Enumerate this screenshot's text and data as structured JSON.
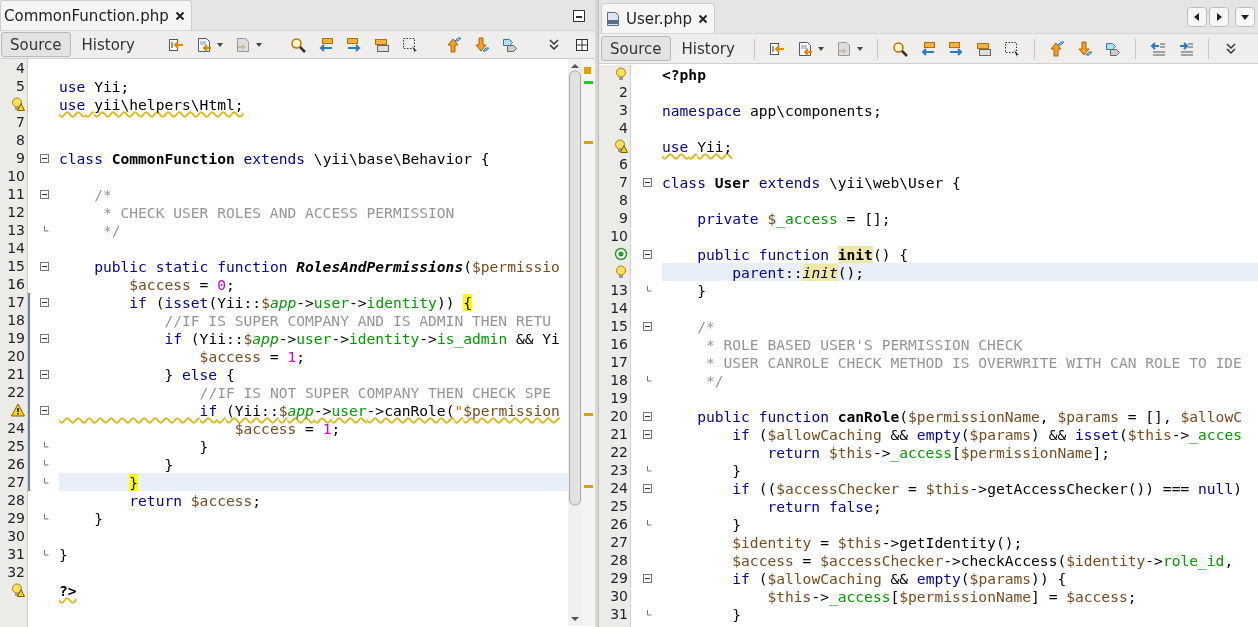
{
  "panes": [
    {
      "tab": {
        "label": "CommonFunction.php"
      },
      "views": [
        {
          "label": "Source",
          "selected": true
        },
        {
          "label": "History",
          "selected": false
        }
      ],
      "lines": [
        {
          "n": "4",
          "current": false
        },
        {
          "n": "5",
          "current": false,
          "code": [
            {
              "kind": "keyword",
              "text": "use"
            },
            {
              "kind": "plain",
              "text": " Yii;"
            }
          ]
        },
        {
          "annotation": {
            "kind": "bulb-warning"
          },
          "squiggle": true,
          "current": false,
          "code": [
            {
              "kind": "keyword",
              "text": "use"
            },
            {
              "kind": "plain",
              "text": " yii\\helpers\\Html;"
            }
          ]
        },
        {
          "n": "7",
          "current": false
        },
        {
          "n": "8",
          "current": false
        },
        {
          "n": "9",
          "fold": {
            "kind": "open"
          },
          "current": false,
          "code": [
            {
              "kind": "keyword",
              "text": "class "
            },
            {
              "kind": "bold",
              "text": "CommonFunction"
            },
            {
              "kind": "keyword",
              "text": " extends"
            },
            {
              "kind": "plain",
              "text": " \\yii\\base\\Behavior {"
            }
          ]
        },
        {
          "n": "10",
          "current": false
        },
        {
          "n": "11",
          "fold": {
            "kind": "open"
          },
          "current": false,
          "code": [
            {
              "kind": "comment",
              "text": "    /*"
            }
          ]
        },
        {
          "n": "12",
          "current": false,
          "code": [
            {
              "kind": "comment",
              "text": "     * CHECK USER ROLES AND ACCESS PERMISSION"
            }
          ]
        },
        {
          "n": "13",
          "fold": {
            "kind": "end"
          },
          "current": false,
          "code": [
            {
              "kind": "comment",
              "text": "     */"
            }
          ]
        },
        {
          "n": "14",
          "current": false
        },
        {
          "n": "15",
          "fold": {
            "kind": "open"
          },
          "current": false,
          "code": [
            {
              "kind": "keyword",
              "text": "    public static function "
            },
            {
              "kind": "bold-italic",
              "text": "RolesAndPermissions"
            },
            {
              "kind": "plain",
              "text": "("
            },
            {
              "kind": "variable",
              "text": "$permissio"
            }
          ]
        },
        {
          "n": "16",
          "current": false,
          "code": [
            {
              "kind": "variable",
              "text": "        $access"
            },
            {
              "kind": "plain",
              "text": " = "
            },
            {
              "kind": "number",
              "text": "0"
            },
            {
              "kind": "plain",
              "text": ";"
            }
          ]
        },
        {
          "n": "17",
          "fold": {
            "kind": "open"
          },
          "changed": true,
          "current": false,
          "code": [
            {
              "kind": "keyword",
              "text": "        if"
            },
            {
              "kind": "plain",
              "text": " ("
            },
            {
              "kind": "keyword",
              "text": "isset"
            },
            {
              "kind": "plain",
              "text": "(Yii::"
            },
            {
              "kind": "variable",
              "text": "$"
            },
            {
              "kind": "field-italic",
              "text": "app"
            },
            {
              "kind": "plain",
              "text": "->"
            },
            {
              "kind": "field",
              "text": "user"
            },
            {
              "kind": "plain",
              "text": "->"
            },
            {
              "kind": "field",
              "text": "identity"
            },
            {
              "kind": "plain",
              "text": ")) "
            },
            {
              "kind": "brace-match",
              "text": "{"
            }
          ]
        },
        {
          "n": "18",
          "changed": true,
          "current": false,
          "code": [
            {
              "kind": "comment",
              "text": "            //IF IS SUPER COMPANY AND IS ADMIN THEN RETU"
            }
          ]
        },
        {
          "n": "19",
          "fold": {
            "kind": "open"
          },
          "changed": true,
          "current": false,
          "code": [
            {
              "kind": "keyword",
              "text": "            if"
            },
            {
              "kind": "plain",
              "text": " (Yii::"
            },
            {
              "kind": "variable",
              "text": "$"
            },
            {
              "kind": "field-italic",
              "text": "app"
            },
            {
              "kind": "plain",
              "text": "->"
            },
            {
              "kind": "field",
              "text": "user"
            },
            {
              "kind": "plain",
              "text": "->"
            },
            {
              "kind": "field",
              "text": "identity"
            },
            {
              "kind": "plain",
              "text": "->"
            },
            {
              "kind": "field",
              "text": "is_admin"
            },
            {
              "kind": "plain",
              "text": " && Yi"
            }
          ]
        },
        {
          "n": "20",
          "changed": true,
          "current": false,
          "code": [
            {
              "kind": "variable",
              "text": "                $access"
            },
            {
              "kind": "plain",
              "text": " = "
            },
            {
              "kind": "number",
              "text": "1"
            },
            {
              "kind": "plain",
              "text": ";"
            }
          ]
        },
        {
          "n": "21",
          "fold": {
            "kind": "open"
          },
          "changed": true,
          "current": false,
          "code": [
            {
              "kind": "plain",
              "text": "            } "
            },
            {
              "kind": "keyword",
              "text": "else"
            },
            {
              "kind": "plain",
              "text": " {"
            }
          ]
        },
        {
          "n": "22",
          "changed": true,
          "current": false,
          "code": [
            {
              "kind": "comment",
              "text": "                //IF IS NOT SUPER COMPANY THEN CHECK SPE"
            }
          ]
        },
        {
          "annotation": {
            "kind": "warning"
          },
          "fold": {
            "kind": "open"
          },
          "squiggle": true,
          "changed": true,
          "current": false,
          "code": [
            {
              "kind": "keyword",
              "text": "                if"
            },
            {
              "kind": "plain",
              "text": " (Yii::"
            },
            {
              "kind": "variable",
              "text": "$"
            },
            {
              "kind": "field-italic",
              "text": "app"
            },
            {
              "kind": "plain",
              "text": "->"
            },
            {
              "kind": "field",
              "text": "user"
            },
            {
              "kind": "plain",
              "text": "->canRole("
            },
            {
              "kind": "string",
              "text": "\""
            },
            {
              "kind": "variable",
              "text": "$permission"
            }
          ]
        },
        {
          "n": "24",
          "changed": true,
          "current": false,
          "code": [
            {
              "kind": "variable",
              "text": "                    $access"
            },
            {
              "kind": "plain",
              "text": " = "
            },
            {
              "kind": "number",
              "text": "1"
            },
            {
              "kind": "plain",
              "text": ";"
            }
          ]
        },
        {
          "n": "25",
          "fold": {
            "kind": "end"
          },
          "changed": true,
          "current": false,
          "code": [
            {
              "kind": "plain",
              "text": "                }"
            }
          ]
        },
        {
          "n": "26",
          "fold": {
            "kind": "end"
          },
          "changed": true,
          "current": false,
          "code": [
            {
              "kind": "plain",
              "text": "            }"
            }
          ]
        },
        {
          "n": "27",
          "fold": {
            "kind": "end"
          },
          "changed": true,
          "current": true,
          "code": [
            {
              "kind": "brace-match",
              "text": "        }"
            }
          ]
        },
        {
          "n": "28",
          "current": false,
          "code": [
            {
              "kind": "keyword",
              "text": "        return"
            },
            {
              "kind": "variable",
              "text": " $access"
            },
            {
              "kind": "plain",
              "text": ";"
            }
          ]
        },
        {
          "n": "29",
          "fold": {
            "kind": "end"
          },
          "current": false,
          "code": [
            {
              "kind": "plain",
              "text": "    }"
            }
          ]
        },
        {
          "n": "30",
          "current": false
        },
        {
          "n": "31",
          "fold": {
            "kind": "end"
          },
          "current": false,
          "code": [
            {
              "kind": "plain",
              "text": "}"
            }
          ]
        },
        {
          "n": "32",
          "current": false
        },
        {
          "annotation": {
            "kind": "bulb-warning"
          },
          "squiggle": true,
          "current": false,
          "code": [
            {
              "kind": "bold",
              "text": "?>"
            }
          ]
        }
      ]
    },
    {
      "tab": {
        "label": "User.php"
      },
      "views": [
        {
          "label": "Source",
          "selected": true
        },
        {
          "label": "History",
          "selected": false
        }
      ],
      "lines": [
        {
          "annotation": {
            "kind": "bulb"
          },
          "current": false,
          "code": [
            {
              "kind": "bold",
              "text": "<?php"
            }
          ]
        },
        {
          "n": "2",
          "current": false
        },
        {
          "n": "3",
          "current": false,
          "code": [
            {
              "kind": "keyword",
              "text": "namespace"
            },
            {
              "kind": "plain",
              "text": " app\\components;"
            }
          ]
        },
        {
          "n": "4",
          "current": false
        },
        {
          "annotation": {
            "kind": "bulb-warning"
          },
          "squiggle": true,
          "current": false,
          "code": [
            {
              "kind": "keyword",
              "text": "use"
            },
            {
              "kind": "plain",
              "text": " Yii;"
            }
          ]
        },
        {
          "n": "6",
          "current": false
        },
        {
          "n": "7",
          "fold": {
            "kind": "open"
          },
          "current": false,
          "code": [
            {
              "kind": "keyword",
              "text": "class "
            },
            {
              "kind": "bold",
              "text": "User"
            },
            {
              "kind": "keyword",
              "text": " extends"
            },
            {
              "kind": "plain",
              "text": " \\yii\\web\\User {"
            }
          ]
        },
        {
          "n": "8",
          "current": false
        },
        {
          "n": "9",
          "current": false,
          "code": [
            {
              "kind": "keyword",
              "text": "    private"
            },
            {
              "kind": "variable",
              "text": " $"
            },
            {
              "kind": "field",
              "text": "_access"
            },
            {
              "kind": "plain",
              "text": " = [];"
            }
          ]
        },
        {
          "n": "10",
          "current": false
        },
        {
          "annotation": {
            "kind": "override"
          },
          "fold": {
            "kind": "open"
          },
          "current": false,
          "code": [
            {
              "kind": "keyword",
              "text": "    public function "
            },
            {
              "kind": "occurrence-bold",
              "text": "init"
            },
            {
              "kind": "plain",
              "text": "() {"
            }
          ]
        },
        {
          "annotation": {
            "kind": "bulb"
          },
          "current": true,
          "code": [
            {
              "kind": "keyword",
              "text": "        parent"
            },
            {
              "kind": "plain",
              "text": "::"
            },
            {
              "kind": "occurrence-italic",
              "text": "init"
            },
            {
              "kind": "plain",
              "text": "();"
            }
          ]
        },
        {
          "n": "13",
          "fold": {
            "kind": "end"
          },
          "current": false,
          "code": [
            {
              "kind": "plain",
              "text": "    }"
            }
          ]
        },
        {
          "n": "14",
          "current": false
        },
        {
          "n": "15",
          "fold": {
            "kind": "open"
          },
          "current": false,
          "code": [
            {
              "kind": "comment",
              "text": "    /*"
            }
          ]
        },
        {
          "n": "16",
          "current": false,
          "code": [
            {
              "kind": "comment",
              "text": "     * ROLE BASED USER'S PERMISSION CHECK"
            }
          ]
        },
        {
          "n": "17",
          "current": false,
          "code": [
            {
              "kind": "comment",
              "text": "     * USER CANROLE CHECK METHOD IS OVERWRITE WITH CAN ROLE TO IDE"
            }
          ]
        },
        {
          "n": "18",
          "fold": {
            "kind": "end"
          },
          "current": false,
          "code": [
            {
              "kind": "comment",
              "text": "     */"
            }
          ]
        },
        {
          "n": "19",
          "current": false
        },
        {
          "n": "20",
          "fold": {
            "kind": "open"
          },
          "current": false,
          "code": [
            {
              "kind": "keyword",
              "text": "    public function "
            },
            {
              "kind": "bold",
              "text": "canRole"
            },
            {
              "kind": "plain",
              "text": "("
            },
            {
              "kind": "variable",
              "text": "$permissionName"
            },
            {
              "kind": "plain",
              "text": ", "
            },
            {
              "kind": "variable",
              "text": "$params"
            },
            {
              "kind": "plain",
              "text": " = [], "
            },
            {
              "kind": "variable",
              "text": "$allowC"
            }
          ]
        },
        {
          "n": "21",
          "fold": {
            "kind": "open"
          },
          "current": false,
          "code": [
            {
              "kind": "keyword",
              "text": "        if"
            },
            {
              "kind": "plain",
              "text": " ("
            },
            {
              "kind": "variable",
              "text": "$allowCaching"
            },
            {
              "kind": "plain",
              "text": " && "
            },
            {
              "kind": "keyword",
              "text": "empty"
            },
            {
              "kind": "plain",
              "text": "("
            },
            {
              "kind": "variable",
              "text": "$params"
            },
            {
              "kind": "plain",
              "text": ") && "
            },
            {
              "kind": "keyword",
              "text": "isset"
            },
            {
              "kind": "plain",
              "text": "("
            },
            {
              "kind": "variable",
              "text": "$this"
            },
            {
              "kind": "plain",
              "text": "->"
            },
            {
              "kind": "field",
              "text": "_acces"
            }
          ]
        },
        {
          "n": "22",
          "current": false,
          "code": [
            {
              "kind": "keyword",
              "text": "            return"
            },
            {
              "kind": "variable",
              "text": " $this"
            },
            {
              "kind": "plain",
              "text": "->"
            },
            {
              "kind": "field",
              "text": "_access"
            },
            {
              "kind": "plain",
              "text": "["
            },
            {
              "kind": "variable",
              "text": "$permissionName"
            },
            {
              "kind": "plain",
              "text": "];"
            }
          ]
        },
        {
          "n": "23",
          "fold": {
            "kind": "end"
          },
          "current": false,
          "code": [
            {
              "kind": "plain",
              "text": "        }"
            }
          ]
        },
        {
          "n": "24",
          "fold": {
            "kind": "open"
          },
          "current": false,
          "code": [
            {
              "kind": "keyword",
              "text": "        if"
            },
            {
              "kind": "plain",
              "text": " (("
            },
            {
              "kind": "variable",
              "text": "$accessChecker"
            },
            {
              "kind": "plain",
              "text": " = "
            },
            {
              "kind": "variable",
              "text": "$this"
            },
            {
              "kind": "plain",
              "text": "->getAccessChecker()) === "
            },
            {
              "kind": "keyword",
              "text": "null"
            },
            {
              "kind": "plain",
              "text": ")"
            }
          ]
        },
        {
          "n": "25",
          "current": false,
          "code": [
            {
              "kind": "keyword",
              "text": "            return false"
            },
            {
              "kind": "plain",
              "text": ";"
            }
          ]
        },
        {
          "n": "26",
          "fold": {
            "kind": "end"
          },
          "current": false,
          "code": [
            {
              "kind": "plain",
              "text": "        }"
            }
          ]
        },
        {
          "n": "27",
          "current": false,
          "code": [
            {
              "kind": "variable",
              "text": "        $identity"
            },
            {
              "kind": "plain",
              "text": " = "
            },
            {
              "kind": "variable",
              "text": "$this"
            },
            {
              "kind": "plain",
              "text": "->getIdentity();"
            }
          ]
        },
        {
          "n": "28",
          "current": false,
          "code": [
            {
              "kind": "variable",
              "text": "        $access"
            },
            {
              "kind": "plain",
              "text": " = "
            },
            {
              "kind": "variable",
              "text": "$accessChecker"
            },
            {
              "kind": "plain",
              "text": "->checkAccess("
            },
            {
              "kind": "variable",
              "text": "$identity"
            },
            {
              "kind": "plain",
              "text": "->"
            },
            {
              "kind": "field",
              "text": "role_id"
            },
            {
              "kind": "plain",
              "text": ","
            }
          ]
        },
        {
          "n": "29",
          "fold": {
            "kind": "open"
          },
          "current": false,
          "code": [
            {
              "kind": "keyword",
              "text": "        if"
            },
            {
              "kind": "plain",
              "text": " ("
            },
            {
              "kind": "variable",
              "text": "$allowCaching"
            },
            {
              "kind": "plain",
              "text": " && "
            },
            {
              "kind": "keyword",
              "text": "empty"
            },
            {
              "kind": "plain",
              "text": "("
            },
            {
              "kind": "variable",
              "text": "$params"
            },
            {
              "kind": "plain",
              "text": ")) {"
            }
          ]
        },
        {
          "n": "30",
          "current": false,
          "code": [
            {
              "kind": "variable",
              "text": "            $this"
            },
            {
              "kind": "plain",
              "text": "->"
            },
            {
              "kind": "field",
              "text": "_access"
            },
            {
              "kind": "plain",
              "text": "["
            },
            {
              "kind": "variable",
              "text": "$permissionName"
            },
            {
              "kind": "plain",
              "text": "] = "
            },
            {
              "kind": "variable",
              "text": "$access"
            },
            {
              "kind": "plain",
              "text": ";"
            }
          ]
        },
        {
          "n": "31",
          "fold": {
            "kind": "end"
          },
          "current": false,
          "code": [
            {
              "kind": "plain",
              "text": "        }"
            }
          ]
        }
      ]
    }
  ]
}
